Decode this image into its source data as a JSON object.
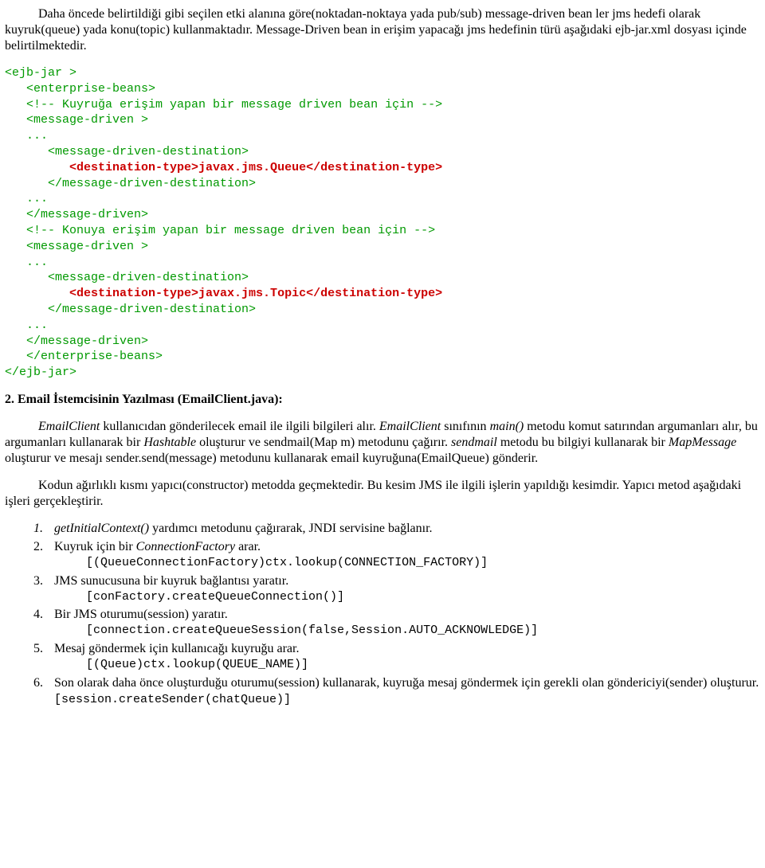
{
  "p1": "Daha öncede belirtildiği gibi seçilen etki alanına göre(noktadan-noktaya yada pub/sub) message-driven bean ler jms hedefi olarak kuyruk(queue) yada konu(topic) kullanmaktadır. Message-Driven bean in erişim yapacağı jms hedefinin türü aşağıdaki ejb-jar.xml dosyası içinde belirtilmektedir.",
  "code1": {
    "l1": "<ejb-jar >",
    "l2": "   <enterprise-beans>",
    "l3": "   <!-- Kuyruğa erişim yapan bir message driven bean için -->",
    "l4": "   <message-driven >",
    "l5": "   ...",
    "l6": "      <message-driven-destination>",
    "l7a": "         <destination-type>",
    "l7b": "javax.jms.Queue",
    "l7c": "</destination-type>",
    "l8": "      </message-driven-destination>",
    "l9": "   ...",
    "l10": "   </message-driven>",
    "l11": "   <!-- Konuya erişim yapan bir message driven bean için -->",
    "l12": "   <message-driven >",
    "l13": "   ...",
    "l14": "      <message-driven-destination>",
    "l15a": "         <destination-type>",
    "l15b": "javax.jms.Topic",
    "l15c": "</destination-type>",
    "l16": "      </message-driven-destination>",
    "l17": "   ...",
    "l18": "   </message-driven>",
    "l19": "   </enterprise-beans>",
    "l20": "</ejb-jar>"
  },
  "h2": "2. Email İstemcisinin Yazılması (EmailClient.java):",
  "p2a": "EmailClient",
  "p2b": " kullanıcıdan gönderilecek email ile ilgili bilgileri alır. ",
  "p2c": "EmailClient",
  "p2d": " sınıfının ",
  "p2e": "main()",
  "p2f": " metodu komut satırından argumanları alır, bu argumanları kullanarak bir ",
  "p2g": "Hashtable",
  "p2h": " oluşturur ve sendmail(Map m) metodunu çağırır. ",
  "p2i": "sendmail",
  "p2j": " metodu bu bilgiyi kullanarak bir ",
  "p2k": "MapMessage",
  "p2l": " oluşturur ve mesajı sender.send(message) metodunu kullanarak email kuyruğuna(EmailQueue) gönderir.",
  "p3": "Kodun ağırlıklı kısmı yapıcı(constructor) metodda geçmektedir. Bu kesim JMS ile ilgili işlerin yapıldığı kesimdir. Yapıcı metod aşağıdaki işleri gerçekleştirir.",
  "list": {
    "i1a": "getInitialContext()",
    "i1b": " yardımcı metodunu çağırarak, JNDI servisine bağlanır.",
    "i2a": "Kuyruk için bir ",
    "i2b": "ConnectionFactory ",
    "i2c": "arar.",
    "i2code": "[(QueueConnectionFactory)ctx.lookup(CONNECTION_FACTORY)]",
    "i3a": "JMS sunucusuna bir kuyruk bağlantısı yaratır.",
    "i3code": "[conFactory.createQueueConnection()]",
    "i4a": "Bir JMS oturumu(session) yaratır.",
    "i4code": "[connection.createQueueSession(false,Session.AUTO_ACKNOWLEDGE)]",
    "i5a": "Mesaj göndermek için kullanıcağı kuyruğu arar.",
    "i5code": "[(Queue)ctx.lookup(QUEUE_NAME)]",
    "i6a": "Son olarak daha önce oluşturduğu oturumu(session) kullanarak, kuyruğa mesaj göndermek için gerekli olan göndericiyi(sender) oluşturur. ",
    "i6code": "[session.createSender(chatQueue)]"
  }
}
